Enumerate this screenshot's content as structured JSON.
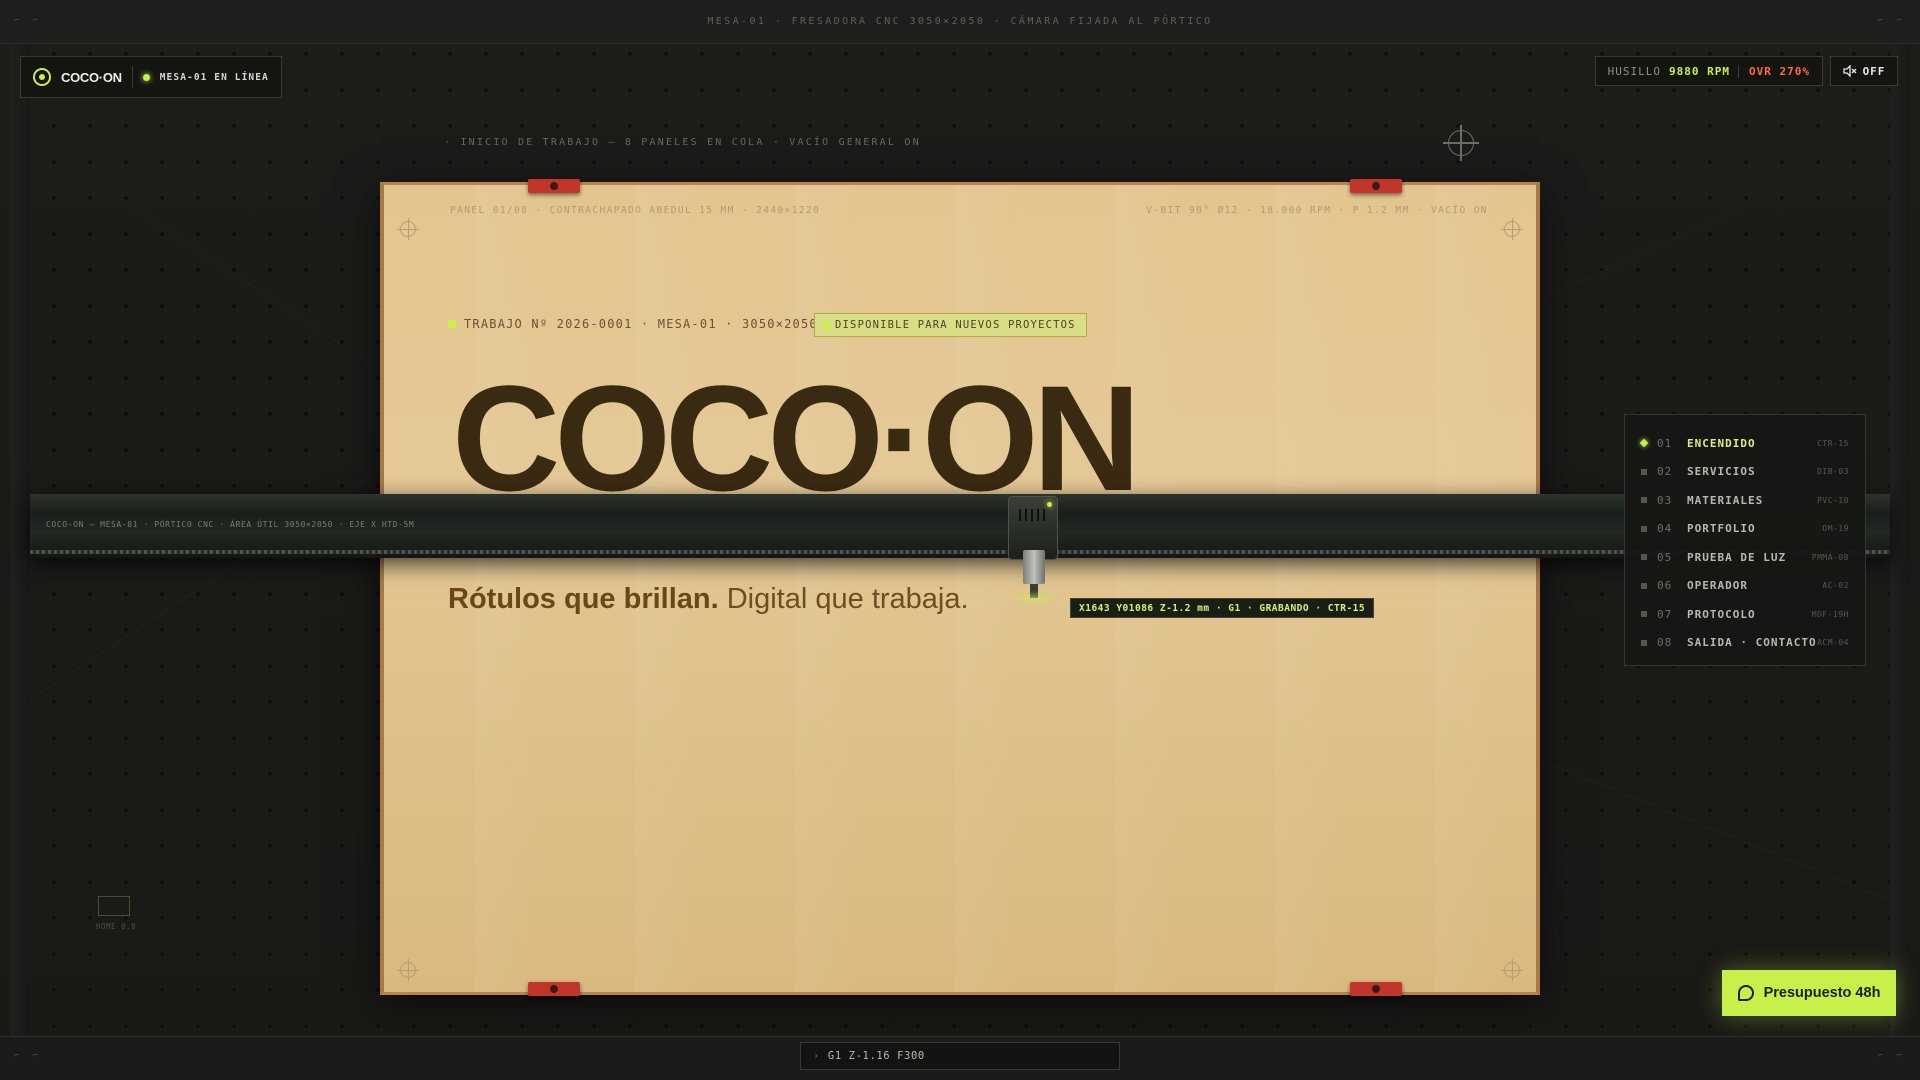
{
  "top_bar": {
    "title": "MESA-01 · FRESADORA CNC 3050×2050 · CÁMARA FIJADA AL PÓRTICO",
    "corner_marks": "⌐ ⌐"
  },
  "brand": {
    "name": "COCO·ON",
    "status": "MESA-01 EN LÍNEA"
  },
  "spindle": {
    "label": "HUSILLO",
    "rpm": "9880 RPM",
    "override": "OVR 270%"
  },
  "sound": {
    "label": "OFF",
    "icon": "muted-speaker-icon"
  },
  "cue": "· INICIO DE TRABAJO — 8 PANELES EN COLA · VACÍO GENERAL ON",
  "panel": {
    "meta_left": "PANEL 01/08 · CONTRACHAPADO ABEDUL 15 MM · 2440×1220",
    "meta_right": "V-BIT 90° Ø12 · 18.000 RPM · P 1.2 MM · VACÍO ON",
    "job": "TRABAJO Nº 2026-0001 · MESA-01 · 3050×2050",
    "availability": "DISPONIBLE PARA NUEVOS PROYECTOS",
    "hero": "COCO·ON",
    "tagline_bold": "Rótulos que brillan.",
    "tagline_rest": " Digital que trabaja."
  },
  "gantry": {
    "label": "COCO-ON — MESA-01 · PÓRTICO CNC · ÁREA ÚTIL 3050×2050 · EJE X HTD-5M"
  },
  "toolhead_readout": "X1643 Y01086 Z-1.2 mm · G1 · GRABANDO · CTR-15",
  "nav": {
    "items": [
      {
        "num": "01",
        "label": "ENCENDIDO",
        "code": "CTR-15",
        "active": true
      },
      {
        "num": "02",
        "label": "SERVICIOS",
        "code": "DIB-03"
      },
      {
        "num": "03",
        "label": "MATERIALES",
        "code": "PVC-10"
      },
      {
        "num": "04",
        "label": "PORTFOLIO",
        "code": "DM-19"
      },
      {
        "num": "05",
        "label": "PRUEBA DE LUZ",
        "code": "PMMA-08"
      },
      {
        "num": "06",
        "label": "OPERADOR",
        "code": "AC-02"
      },
      {
        "num": "07",
        "label": "PROTOCOLO",
        "code": "MDF-19H"
      },
      {
        "num": "08",
        "label": "SALIDA · CONTACTO",
        "code": "ACM-04"
      }
    ]
  },
  "home_label": "HOME 0,0",
  "cta": {
    "label": "Presupuesto 48h",
    "icon": "chat-bubble-icon"
  },
  "console": {
    "prompt": "›",
    "text": "G1 Z-1.16 F300"
  },
  "colors": {
    "accent": "#c7f04a",
    "warning": "#ff6a3c",
    "wood": "#e3c590",
    "ink": "#3b2a12"
  }
}
